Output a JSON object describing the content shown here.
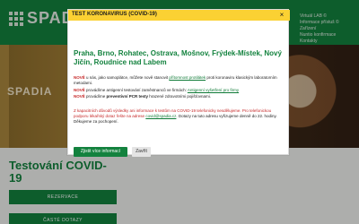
{
  "header": {
    "logo_text": "SPAD",
    "right_lines": [
      "Virtuál LAB ©",
      "Informace přístuš ©",
      "Zařízení",
      "Nuntio konfirmace",
      "Kontakty"
    ]
  },
  "hero": {
    "brand_text": "SPADIA"
  },
  "page": {
    "title": "Testování COVID-19",
    "reserve_button": "REZERVACE",
    "faq_button": "ČASTÉ DOTAZY"
  },
  "modal": {
    "title": "TEST KORONAVIRUS (COVID-19)",
    "close_symbol": "×",
    "heading": "Praha, Brno, Rohatec, Ostrava, Mošnov, Frýdek-Místek, Nový Jičín, Roudnice nad Labem",
    "p1_new": "NOVĚ",
    "p1_text_a": " u nás, jako samoplátce, můžete nově stanovit ",
    "p1_link": "přítomnost protilátek",
    "p1_text_b": " proti koronaviru klasickým laboratorním metodami.",
    "p2_new": "NOVĚ",
    "p2_text_a": " provádíme antigenní testování zaměstnanců ve firmách: ",
    "p2_link": "Antigenní vyšetření pro firmy",
    "p3_new": "NOVĚ",
    "p3_text_a": " provádíme ",
    "p3_bold": "preventivní PCR testy",
    "p3_text_b": " hrazené zdravotními pojišťovnami.",
    "p4_red": "Z kapacitních důvodů výsledky ani informace k testům na COVID-19 telefonicky nesdělujeme. Pro telefonickou podporu ",
    "p4_text_a": "lékařský dotaz řešte na adrese ",
    "p4_link": "covid@spadia.cz",
    "p4_text_b": ". Dotazy na tuto adresu vyřizujeme denně do 22. hodiny. Děkujeme za pochopení.",
    "more_button": "Zjistit více informací",
    "close_button": "Zavřít"
  },
  "colors": {
    "brand_green": "#13823e",
    "warning_yellow": "#fbd133",
    "alert_red": "#c62828"
  }
}
